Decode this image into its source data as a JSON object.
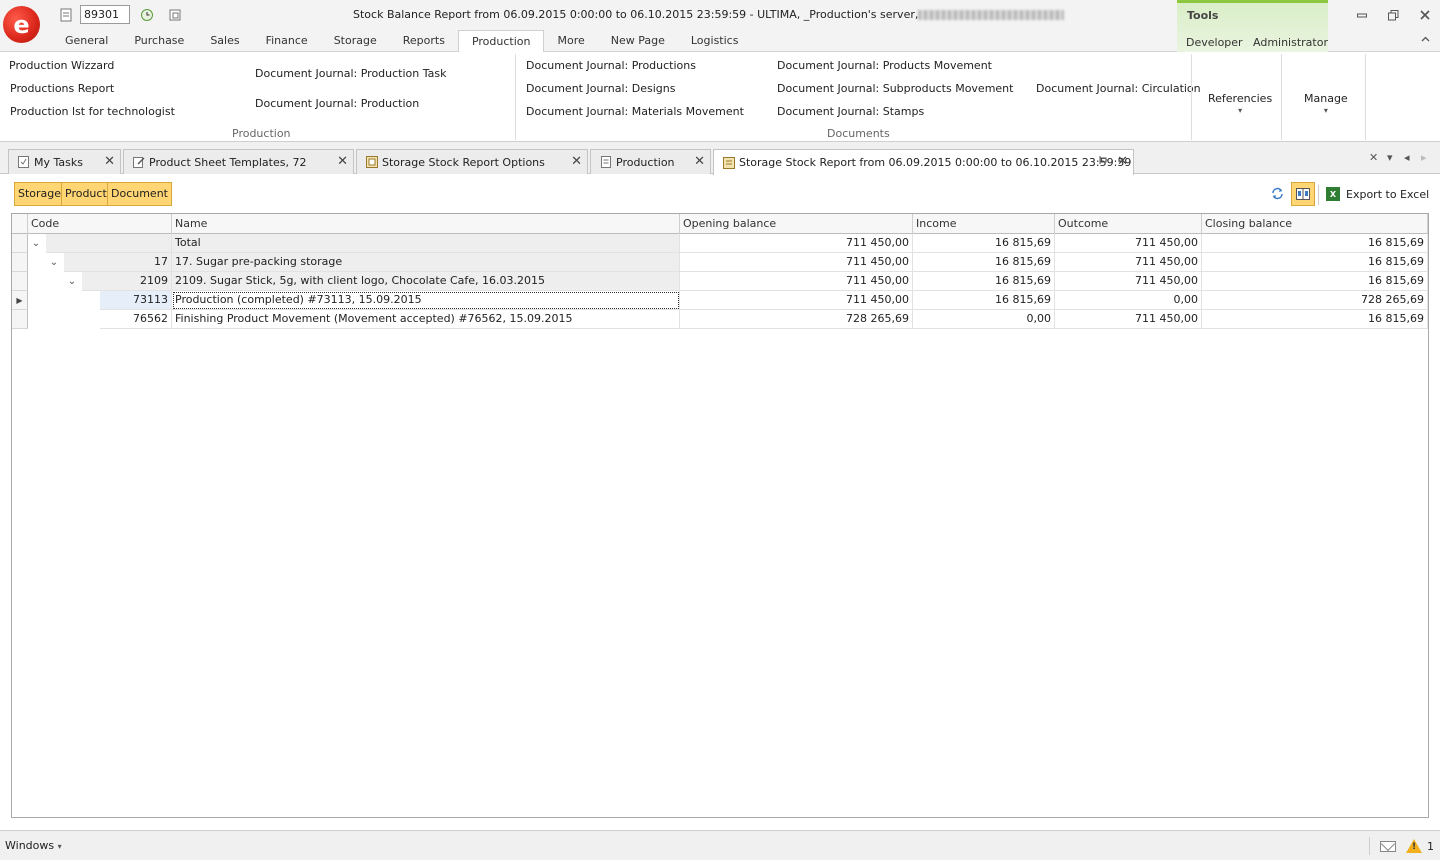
{
  "window": {
    "title": "Stock Balance Report from 06.09.2015 0:00:00 to 06.10.2015 23:59:59 - ULTIMA, _Production's server,",
    "logo_letter": "e",
    "doc_number": "89301"
  },
  "menu": {
    "tabs": [
      "General",
      "Purchase",
      "Sales",
      "Finance",
      "Storage",
      "Reports",
      "Production",
      "More",
      "New Page",
      "Logistics"
    ],
    "active_tab": "Production",
    "tools_title": "Tools",
    "tools_tabs": [
      "Developer",
      "Administrator"
    ]
  },
  "ribbon": {
    "production_group": {
      "caption": "Production",
      "links": [
        "Production Wizzard",
        "Productions Report",
        "Production lst for technologist",
        "Document Journal: Production Task",
        "Document Journal: Production"
      ]
    },
    "documents_group": {
      "caption": "Documents",
      "links": [
        "Document Journal: Productions",
        "Document Journal: Designs",
        "Document Journal: Materials Movement",
        "Document Journal: Products Movement",
        "Document Journal: Subproducts Movement",
        "Document Journal: Stamps",
        "Document Journal: Circulation"
      ]
    },
    "buttons": [
      "Referencies",
      "Manage"
    ]
  },
  "doc_tabs": [
    {
      "label": "My Tasks",
      "icon": "task-icon"
    },
    {
      "label": "Product Sheet Templates, 72",
      "icon": "edit-icon"
    },
    {
      "label": "Storage Stock Report Options",
      "icon": "report-options-icon"
    },
    {
      "label": "Production",
      "icon": "document-icon"
    },
    {
      "label": "Storage Stock Report from 06.09.2015 0:00:00 to 06.10.2015 23:59:59",
      "icon": "report-icon",
      "active": true
    }
  ],
  "toolbar": {
    "group_fields": [
      "Storage",
      "Product",
      "Document"
    ],
    "export_label": "Export to Excel",
    "excel_icon_text": "X"
  },
  "grid": {
    "columns": [
      "Code",
      "Name",
      "Opening balance",
      "Income",
      "Outcome",
      "Closing balance"
    ],
    "rows": [
      {
        "level": 0,
        "code": "",
        "name": "Total",
        "opening": "711 450,00",
        "income": "16 815,69",
        "outcome": "711 450,00",
        "closing": "16 815,69"
      },
      {
        "level": 1,
        "code": "17",
        "name": "17. Sugar pre-packing storage",
        "opening": "711 450,00",
        "income": "16 815,69",
        "outcome": "711 450,00",
        "closing": "16 815,69"
      },
      {
        "level": 2,
        "code": "2109",
        "name": "2109. Sugar Stick, 5g, with client logo, Chocolate Cafe, 16.03.2015",
        "opening": "711 450,00",
        "income": "16 815,69",
        "outcome": "711 450,00",
        "closing": "16 815,69"
      },
      {
        "level": 3,
        "code": "73113",
        "name": "Production (completed) #73113, 15.09.2015",
        "opening": "711 450,00",
        "income": "16 815,69",
        "outcome": "0,00",
        "closing": "728 265,69"
      },
      {
        "level": 3,
        "code": "76562",
        "name": "Finishing Product Movement (Movement accepted) #76562, 15.09.2015",
        "opening": "728 265,69",
        "income": "0,00",
        "outcome": "711 450,00",
        "closing": "16 815,69"
      }
    ]
  },
  "status": {
    "windows_label": "Windows",
    "warning_count": "1",
    "warning_mark": "!"
  },
  "colors": {
    "accent_green": "#8dc63f",
    "chip_yellow": "#ffd673",
    "logo_red": "#d9261a"
  }
}
